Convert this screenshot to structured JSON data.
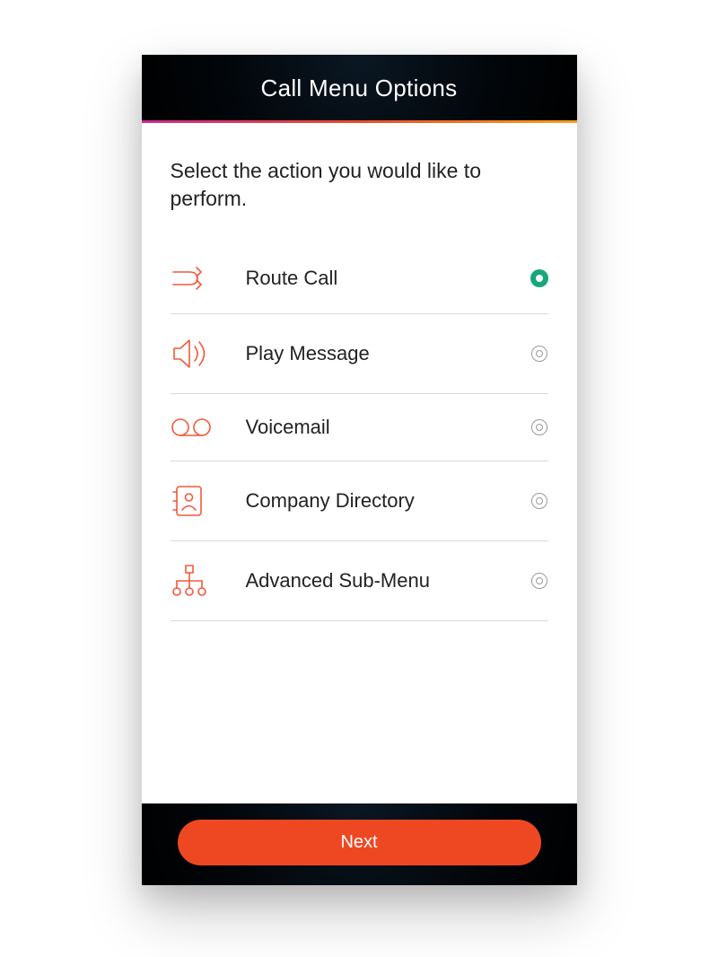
{
  "header": {
    "title": "Call Menu Options"
  },
  "prompt": "Select the action you would like to perform.",
  "options": [
    {
      "label": "Route Call",
      "selected": true
    },
    {
      "label": "Play Message",
      "selected": false
    },
    {
      "label": "Voicemail",
      "selected": false
    },
    {
      "label": "Company Directory",
      "selected": false
    },
    {
      "label": "Advanced Sub-Menu",
      "selected": false
    }
  ],
  "footer": {
    "next_label": "Next"
  },
  "colors": {
    "accent": "#ee4823",
    "icon": "#f2593a",
    "selected": "#18a67b"
  }
}
